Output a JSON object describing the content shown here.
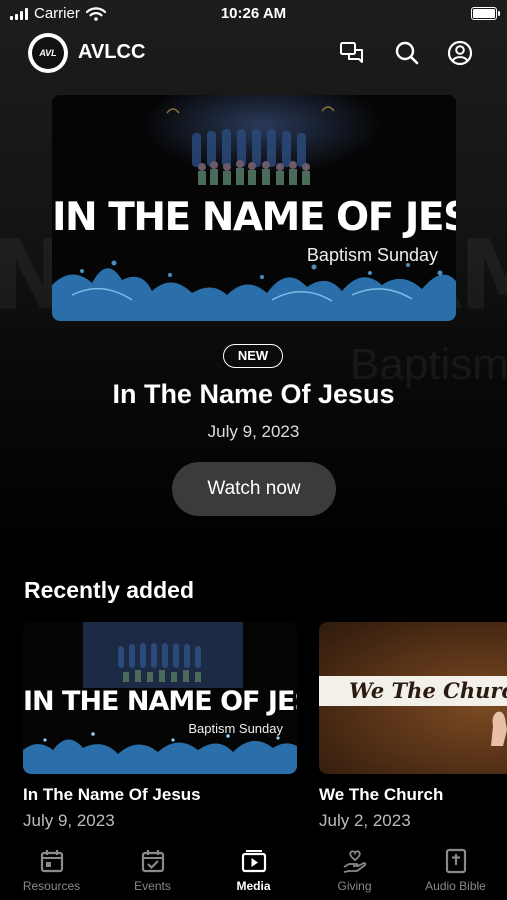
{
  "status_bar": {
    "carrier": "Carrier",
    "time": "10:26 AM"
  },
  "header": {
    "logo_text": "AVL",
    "app_title": "AVLCC"
  },
  "hero": {
    "banner_title": "IN THE NAME OF JESUS",
    "banner_subtitle": "Baptism Sunday",
    "badge": "NEW",
    "title": "In The Name Of Jesus",
    "date": "July 9, 2023",
    "watch_label": "Watch now"
  },
  "recently_added": {
    "heading": "Recently added",
    "items": [
      {
        "banner_title": "IN THE NAME OF JESUS",
        "banner_subtitle": "Baptism Sunday",
        "title": "In The Name Of Jesus",
        "date": "July 9, 2023"
      },
      {
        "banner_text": "We The Church",
        "title": "We The Church",
        "date": "July 2, 2023"
      }
    ]
  },
  "tabs": [
    {
      "label": "Resources",
      "icon": "calendar-day-icon",
      "active": false
    },
    {
      "label": "Events",
      "icon": "calendar-check-icon",
      "active": false
    },
    {
      "label": "Media",
      "icon": "media-play-icon",
      "active": true
    },
    {
      "label": "Giving",
      "icon": "giving-hand-icon",
      "active": false
    },
    {
      "label": "Audio Bible",
      "icon": "bible-icon",
      "active": false
    }
  ],
  "colors": {
    "background": "#000000",
    "button": "#3b3b3b",
    "inactive_tab": "#8a8a8a",
    "water_accent": "#3a8ec4"
  }
}
